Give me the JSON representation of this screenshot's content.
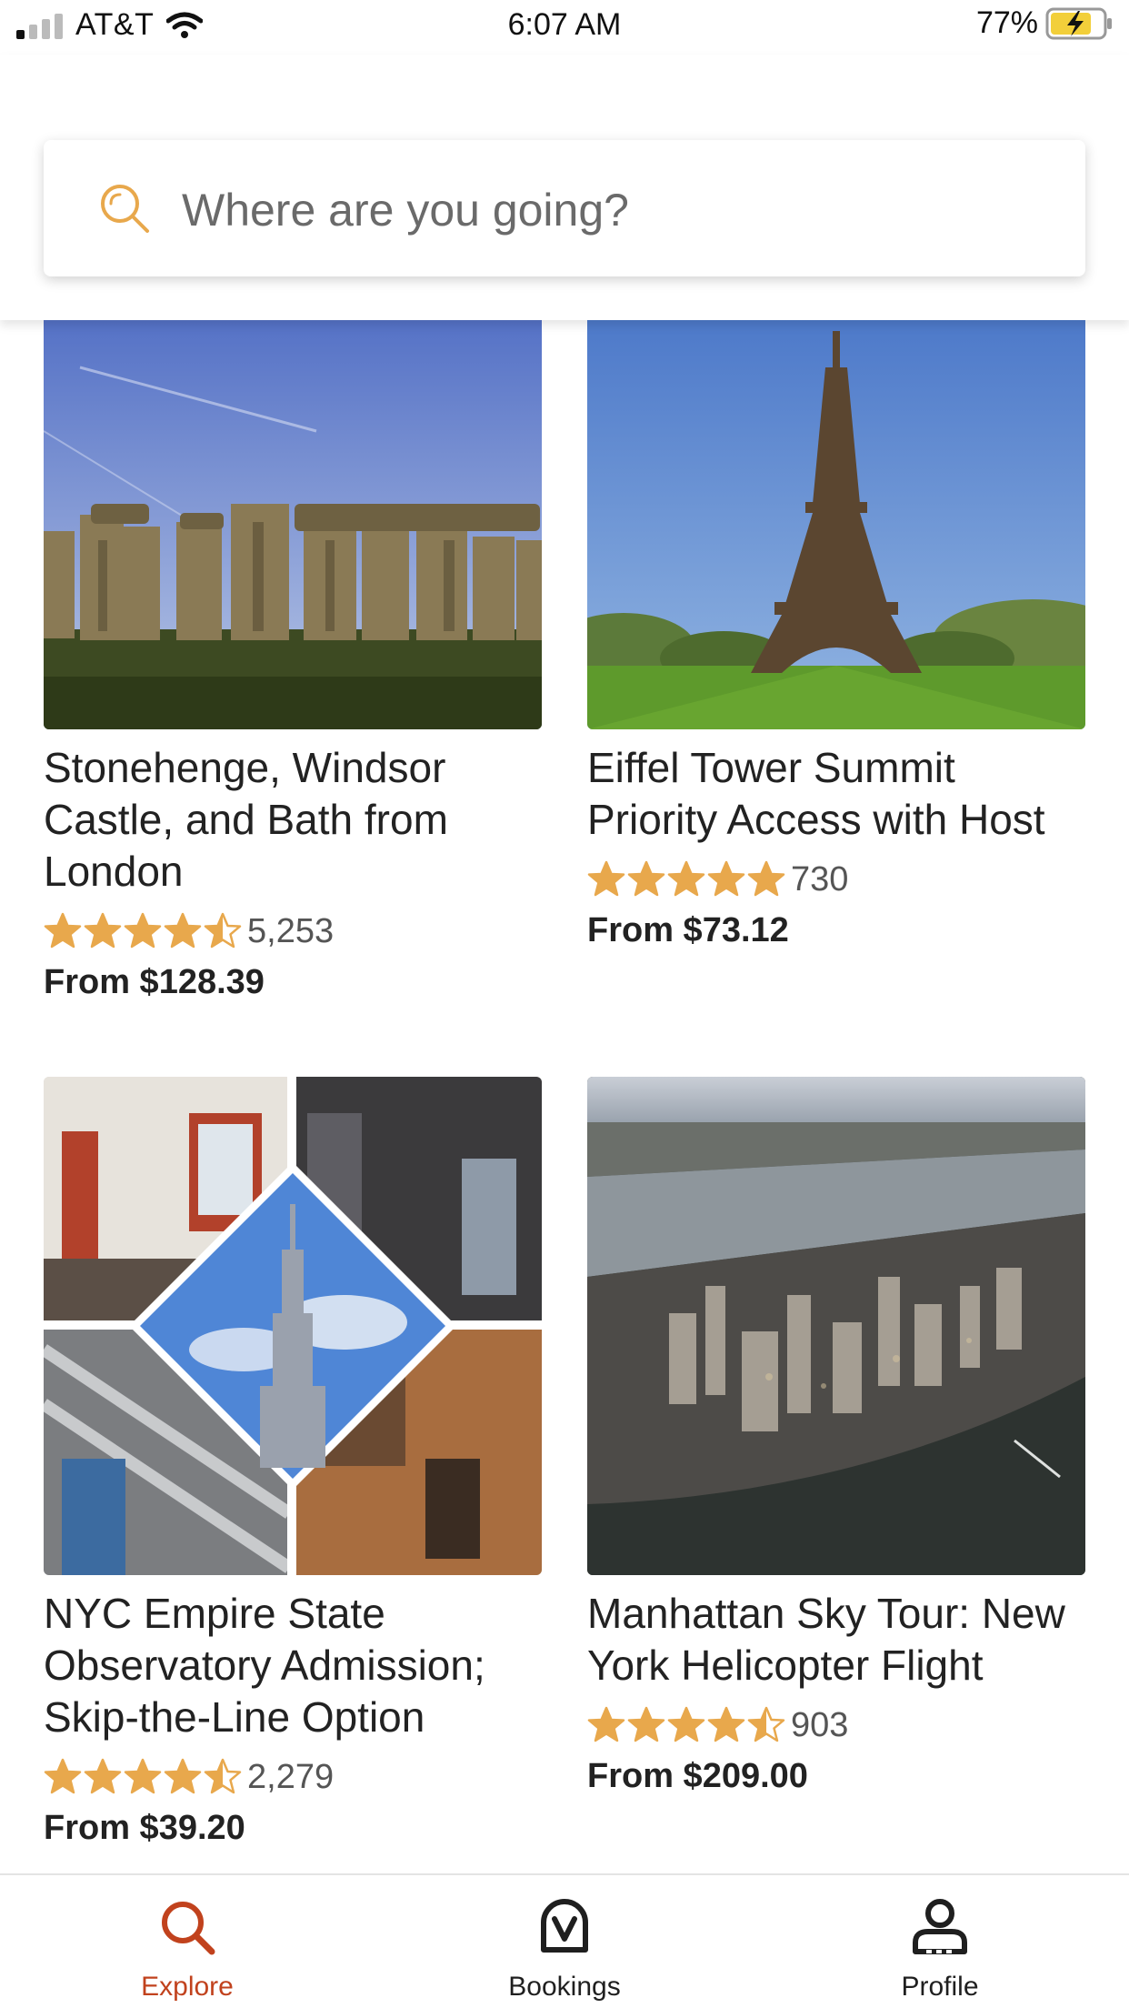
{
  "status_bar": {
    "carrier": "AT&T",
    "time": "6:07 AM",
    "battery": "77%",
    "signal_bars_active": 1,
    "signal_bars_total": 4
  },
  "search": {
    "placeholder": "Where are you going?",
    "icon": "search-icon"
  },
  "colors": {
    "accent": "#c1421d",
    "star": "#e8a84c",
    "battery_fill": "#f2cf3a"
  },
  "cards": [
    {
      "title": "Stonehenge, Windsor Castle, and Bath from London",
      "rating": 4.5,
      "reviews": "5,253",
      "price": "From $128.39",
      "image": "stonehenge-photo"
    },
    {
      "title": "Eiffel Tower Summit Priority Access with Host",
      "rating": 5,
      "reviews": "730",
      "price": "From $73.12",
      "image": "eiffel-tower-photo"
    },
    {
      "title": "NYC Empire State Observatory Admission; Skip-the-Line Option",
      "rating": 4.5,
      "reviews": "2,279",
      "price": "From $39.20",
      "image": "empire-state-collage"
    },
    {
      "title": "Manhattan Sky Tour: New York Helicopter Flight",
      "rating": 4.5,
      "reviews": "903",
      "price": "From $209.00",
      "image": "manhattan-aerial-photo"
    }
  ],
  "tabs": [
    {
      "label": "Explore",
      "icon": "search-icon",
      "active": true
    },
    {
      "label": "Bookings",
      "icon": "bookings-icon",
      "active": false
    },
    {
      "label": "Profile",
      "icon": "profile-icon",
      "active": false
    }
  ]
}
